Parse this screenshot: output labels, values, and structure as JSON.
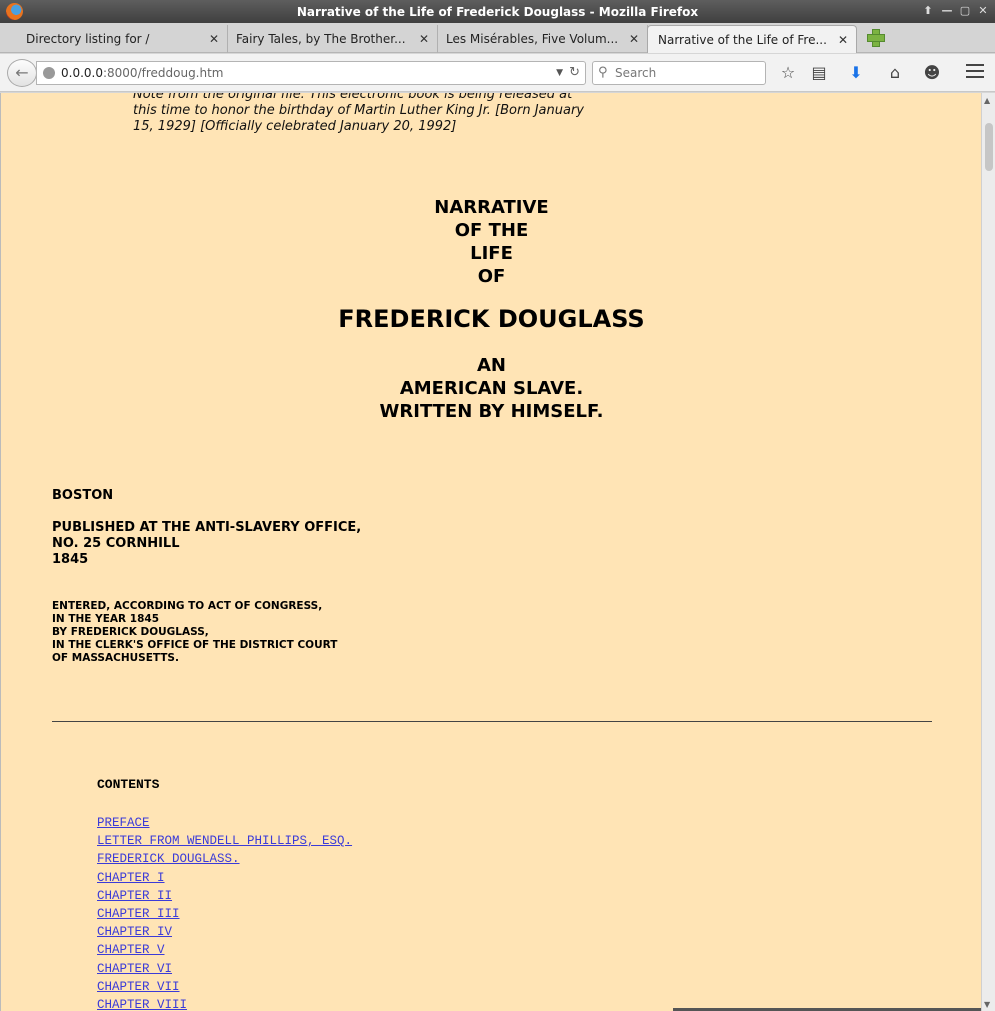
{
  "window": {
    "title": "Narrative of the Life of Frederick Douglass - Mozilla Firefox"
  },
  "tabs": [
    {
      "label": "Directory listing for /",
      "active": false
    },
    {
      "label": "Fairy Tales, by The Brother...",
      "active": false
    },
    {
      "label": "Les Misérables, Five Volum...",
      "active": false
    },
    {
      "label": "Narrative of the Life of Fre...",
      "active": true
    }
  ],
  "navbar": {
    "url_host": "0.0.0.0",
    "url_rest": ":8000/freddoug.htm",
    "search_placeholder": "Search"
  },
  "page": {
    "note": "Note from the original file: This electronic book is being released at this time to honor the birthday of Martin Luther King Jr. [Born January 15, 1929] [Officially celebrated January 20, 1992]",
    "title_lines_small": [
      "NARRATIVE",
      "OF THE",
      "LIFE",
      "OF"
    ],
    "title_main": "FREDERICK DOUGLASS",
    "title_lines_sub": [
      "AN",
      "AMERICAN SLAVE.",
      "WRITTEN BY HIMSELF."
    ],
    "city": "BOSTON",
    "publisher_lines": [
      "PUBLISHED AT THE ANTI-SLAVERY OFFICE,",
      "NO. 25 CORNHILL",
      "1845"
    ],
    "entered_lines": [
      "ENTERED, ACCORDING TO ACT OF CONGRESS,",
      "IN THE YEAR 1845",
      "BY FREDERICK DOUGLASS,",
      "IN THE CLERK'S OFFICE OF THE DISTRICT COURT",
      "OF MASSACHUSETTS."
    ],
    "contents_heading": "CONTENTS",
    "toc": [
      "PREFACE",
      "LETTER FROM WENDELL PHILLIPS, ESQ.",
      "FREDERICK DOUGLASS.",
      "CHAPTER I",
      "CHAPTER II",
      "CHAPTER III",
      "CHAPTER IV",
      "CHAPTER V",
      "CHAPTER VI",
      "CHAPTER VII",
      "CHAPTER VIII"
    ]
  }
}
